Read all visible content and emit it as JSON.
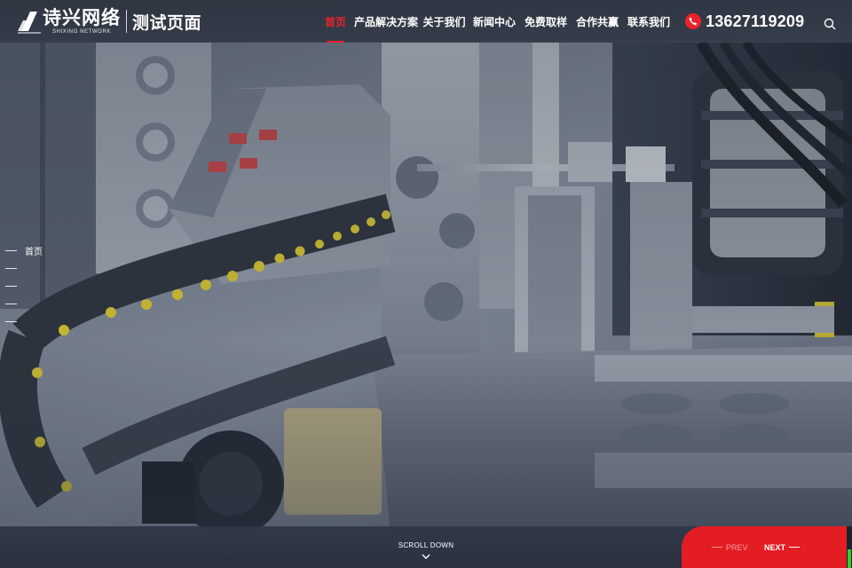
{
  "brand": {
    "name_cn": "诗兴网络",
    "name_en": "SHIXING NETWORK",
    "subtitle": "测试页面"
  },
  "nav": {
    "items": [
      {
        "label": "首页",
        "active": true
      },
      {
        "label": "产品解决方案",
        "active": false
      },
      {
        "label": "关于我们",
        "active": false
      },
      {
        "label": "新闻中心",
        "active": false
      },
      {
        "label": "免费取样",
        "active": false
      },
      {
        "label": "合作共赢",
        "active": false
      },
      {
        "label": "联系我们",
        "active": false
      }
    ]
  },
  "phone": {
    "number": "13627119209",
    "icon": "phone-icon"
  },
  "search": {
    "icon": "search-icon"
  },
  "side_nav": {
    "items": [
      {
        "label": "首页",
        "active": true
      },
      {
        "label": "",
        "active": false
      },
      {
        "label": "",
        "active": false
      },
      {
        "label": "",
        "active": false
      },
      {
        "label": "",
        "active": false
      }
    ]
  },
  "scroll": {
    "label": "SCROLL DOWN",
    "icon": "chevron-down-icon"
  },
  "pager": {
    "prev_label": "PREV",
    "next_label": "NEXT",
    "progress": 0.45
  },
  "colors": {
    "accent": "#e41c24",
    "header_bg": "#2f3542",
    "progress": "#33cc33"
  }
}
